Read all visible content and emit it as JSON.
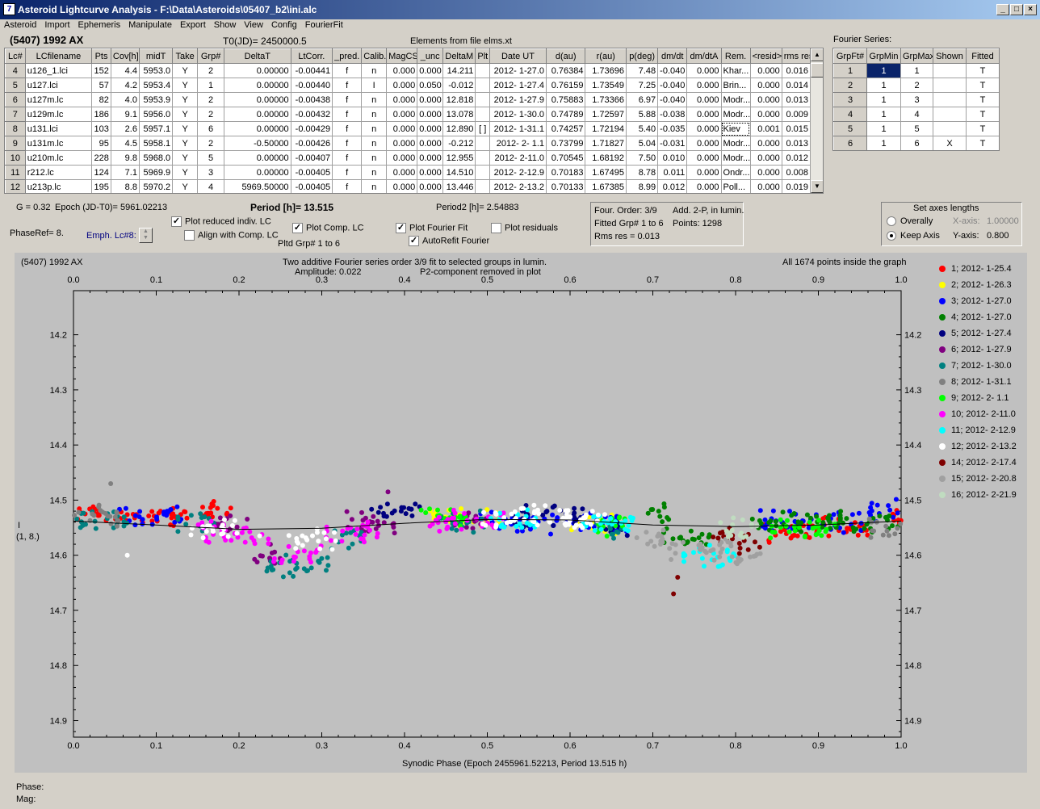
{
  "window": {
    "title": "Asteroid Lightcurve Analysis - F:\\Data\\Asteroids\\05407_b2\\ini.alc",
    "app_icon": "app-logo-icon"
  },
  "menu": [
    "Asteroid",
    "Import",
    "Ephemeris",
    "Manipulate",
    "Export",
    "Show",
    "View",
    "Config",
    "FourierFit"
  ],
  "header": {
    "asteroid": "(5407) 1992 AX",
    "t0": "T0(JD)= 2450000.5",
    "elements": "Elements from file elms.xt"
  },
  "lc_table": {
    "columns": [
      "Lc#",
      "LCfilename",
      "Pts",
      "Cov[h]",
      "midT",
      "Take",
      "Grp#",
      "DeltaT",
      "LtCorr.",
      "_pred.",
      "Calib.",
      "MagCS",
      "_unc",
      "DeltaM",
      "Plt",
      "Date UT",
      "d(au)",
      "r(au)",
      "p(deg)",
      "dm/dt",
      "dm/dtA",
      "Rem.",
      "<resid>",
      "rms res"
    ],
    "rows": [
      [
        "4",
        "u126_1.lci",
        "152",
        "4.4",
        "5953.0",
        "Y",
        "2",
        "0.00000",
        "-0.00441",
        "f",
        "n",
        "0.000",
        "0.000",
        "14.211",
        "",
        "2012- 1-27.0",
        "0.76384",
        "1.73696",
        "7.48",
        "-0.040",
        "0.000",
        "Khar...",
        "0.000",
        "0.016"
      ],
      [
        "5",
        "u127.lci",
        "57",
        "4.2",
        "5953.4",
        "Y",
        "1",
        "0.00000",
        "-0.00440",
        "f",
        "I",
        "0.000",
        "0.050",
        "-0.012",
        "",
        "2012- 1-27.4",
        "0.76159",
        "1.73549",
        "7.25",
        "-0.040",
        "0.000",
        "Brin...",
        "0.000",
        "0.014"
      ],
      [
        "6",
        "u127m.lc",
        "82",
        "4.0",
        "5953.9",
        "Y",
        "2",
        "0.00000",
        "-0.00438",
        "f",
        "n",
        "0.000",
        "0.000",
        "12.818",
        "",
        "2012- 1-27.9",
        "0.75883",
        "1.73366",
        "6.97",
        "-0.040",
        "0.000",
        "Modr...",
        "0.000",
        "0.013"
      ],
      [
        "7",
        "u129m.lc",
        "186",
        "9.1",
        "5956.0",
        "Y",
        "2",
        "0.00000",
        "-0.00432",
        "f",
        "n",
        "0.000",
        "0.000",
        "13.078",
        "",
        "2012- 1-30.0",
        "0.74789",
        "1.72597",
        "5.88",
        "-0.038",
        "0.000",
        "Modr...",
        "0.000",
        "0.009"
      ],
      [
        "8",
        "u131.lci",
        "103",
        "2.6",
        "5957.1",
        "Y",
        "6",
        "0.00000",
        "-0.00429",
        "f",
        "n",
        "0.000",
        "0.000",
        "12.890",
        "[ ]",
        "2012- 1-31.1",
        "0.74257",
        "1.72194",
        "5.40",
        "-0.035",
        "0.000",
        "Kiev",
        "0.001",
        "0.015"
      ],
      [
        "9",
        "u131m.lc",
        "95",
        "4.5",
        "5958.1",
        "Y",
        "2",
        "-0.50000",
        "-0.00426",
        "f",
        "n",
        "0.000",
        "0.000",
        "-0.212",
        "",
        "2012- 2- 1.1",
        "0.73799",
        "1.71827",
        "5.04",
        "-0.031",
        "0.000",
        "Modr...",
        "0.000",
        "0.013"
      ],
      [
        "10",
        "u210m.lc",
        "228",
        "9.8",
        "5968.0",
        "Y",
        "5",
        "0.00000",
        "-0.00407",
        "f",
        "n",
        "0.000",
        "0.000",
        "12.955",
        "",
        "2012- 2-11.0",
        "0.70545",
        "1.68192",
        "7.50",
        "0.010",
        "0.000",
        "Modr...",
        "0.000",
        "0.012"
      ],
      [
        "11",
        "r212.lc",
        "124",
        "7.1",
        "5969.9",
        "Y",
        "3",
        "0.00000",
        "-0.00405",
        "f",
        "n",
        "0.000",
        "0.000",
        "14.510",
        "",
        "2012- 2-12.9",
        "0.70183",
        "1.67495",
        "8.78",
        "0.011",
        "0.000",
        "Ondr...",
        "0.000",
        "0.008"
      ],
      [
        "12",
        "u213p.lc",
        "195",
        "8.8",
        "5970.2",
        "Y",
        "4",
        "5969.50000",
        "-0.00405",
        "f",
        "n",
        "0.000",
        "0.000",
        "13.446",
        "",
        "2012- 2-13.2",
        "0.70133",
        "1.67385",
        "8.99",
        "0.012",
        "0.000",
        "Poll...",
        "0.000",
        "0.019"
      ]
    ]
  },
  "fourier": {
    "title": "Fourier Series:",
    "columns": [
      "GrpFt#",
      "GrpMin",
      "GrpMax",
      "Shown",
      "Fitted"
    ],
    "rows": [
      [
        "1",
        "1",
        "1",
        "",
        "T"
      ],
      [
        "2",
        "1",
        "2",
        "",
        "T"
      ],
      [
        "3",
        "1",
        "3",
        "",
        "T"
      ],
      [
        "4",
        "1",
        "4",
        "",
        "T"
      ],
      [
        "5",
        "1",
        "5",
        "",
        "T"
      ],
      [
        "6",
        "1",
        "6",
        "X",
        "T"
      ]
    ]
  },
  "params": {
    "g": "G = 0.32",
    "epoch": "Epoch (JD-T0)= 5961.02213",
    "period": "Period [h]= 13.515",
    "period2": "Period2 [h]= 2.54883",
    "phaseref": "PhaseRef= 8.",
    "emph": "Emph. Lc#8:",
    "plot_reduced": "Plot reduced indiv. LC",
    "align": "Align with Comp. LC",
    "plot_comp": "Plot Comp. LC",
    "pltd_grp": "Pltd Grp#  1   to    6",
    "plot_fourier": "Plot Fourier Fit",
    "autorefit": "AutoRefit Fourier",
    "plot_resid": "Plot residuals",
    "four_order": "Four. Order:  3/9",
    "add": "Add. 2-P, in lumin.",
    "fitted": "Fitted Grp# 1 to 6",
    "points": "Points: 1298",
    "rms": "Rms res      = 0.013",
    "axes_title": "Set axes lengths",
    "overally": "Overally",
    "keep": "Keep Axis",
    "xaxis_lbl": "X-axis:",
    "xaxis_val": "1.00000",
    "yaxis_lbl": "Y-axis:",
    "yaxis_val": "0.800"
  },
  "plot": {
    "topleft": "(5407) 1992 AX",
    "line1": "Two additive Fourier series order 3/9 fit to selected groups in lumin.",
    "line2": "Amplitude: 0.022",
    "line3": "P2-component removed in plot",
    "topright": "All 1674 points inside the graph",
    "ylabel1": "I",
    "ylabel2": "(1, 8.)",
    "xlabel": "Synodic Phase (Epoch 2455961.52213, Period 13.515 h)"
  },
  "chart_data": {
    "type": "scatter",
    "title": "Two additive Fourier series order 3/9 fit to selected groups in lumin.",
    "xlabel": "Synodic Phase (Epoch 2455961.52213, Period 13.515 h)",
    "ylabel": "I",
    "xlim": [
      0,
      1
    ],
    "ylim": [
      14.93,
      14.12
    ],
    "xticks": [
      "0.0",
      "0.1",
      "0.2",
      "0.3",
      "0.4",
      "0.5",
      "0.6",
      "0.7",
      "0.8",
      "0.9",
      "1.0"
    ],
    "yticks": [
      "14.2",
      "14.3",
      "14.4",
      "14.5",
      "14.6",
      "14.7",
      "14.8",
      "14.9"
    ],
    "legend_position": "right",
    "fourier_fit": [
      [
        0,
        14.538
      ],
      [
        0.1,
        14.545
      ],
      [
        0.2,
        14.553
      ],
      [
        0.3,
        14.551
      ],
      [
        0.4,
        14.542
      ],
      [
        0.5,
        14.535
      ],
      [
        0.6,
        14.536
      ],
      [
        0.7,
        14.545
      ],
      [
        0.8,
        14.548
      ],
      [
        0.9,
        14.545
      ],
      [
        1.0,
        14.538
      ]
    ],
    "series": [
      {
        "name": "1; 2012- 1-25.4",
        "color": "#ff0000",
        "segments": [
          [
            0.0,
            0.03,
            14.52
          ],
          [
            0.03,
            0.14,
            14.53
          ],
          [
            0.15,
            0.2,
            14.52
          ],
          [
            0.82,
            0.89,
            14.56
          ],
          [
            0.89,
            0.96,
            14.55
          ],
          [
            0.99,
            1.0,
            14.53
          ]
        ]
      },
      {
        "name": "2; 2012- 1-26.3",
        "color": "#ffff00",
        "segments": [
          [
            0.43,
            0.52,
            14.535
          ],
          [
            0.6,
            0.66,
            14.54
          ]
        ]
      },
      {
        "name": "3; 2012- 1-27.0",
        "color": "#0000ff",
        "segments": [
          [
            0.05,
            0.13,
            14.53
          ],
          [
            0.49,
            0.67,
            14.54
          ],
          [
            0.83,
            0.96,
            14.54
          ],
          [
            0.96,
            1.0,
            14.52
          ]
        ]
      },
      {
        "name": "4; 2012- 1-27.0",
        "color": "#008000",
        "segments": [
          [
            0.69,
            0.72,
            14.52
          ],
          [
            0.71,
            0.77,
            14.57
          ],
          [
            0.82,
            0.92,
            14.54
          ],
          [
            0.92,
            1.0,
            14.54
          ]
        ]
      },
      {
        "name": "5; 2012- 1-27.4",
        "color": "#00007f",
        "segments": [
          [
            0.36,
            0.42,
            14.52
          ],
          [
            0.53,
            0.62,
            14.53
          ],
          [
            0.64,
            0.67,
            14.55
          ]
        ]
      },
      {
        "name": "6; 2012- 1-27.9",
        "color": "#800080",
        "segments": [
          [
            0.17,
            0.21,
            14.54
          ],
          [
            0.21,
            0.25,
            14.6
          ],
          [
            0.33,
            0.4,
            14.54
          ],
          [
            0.46,
            0.5,
            14.54
          ]
        ]
      },
      {
        "name": "7; 2012- 1-30.0",
        "color": "#008080",
        "segments": [
          [
            0.0,
            0.07,
            14.54
          ],
          [
            0.12,
            0.17,
            14.54
          ],
          [
            0.23,
            0.31,
            14.62
          ],
          [
            0.31,
            0.35,
            14.57
          ],
          [
            0.44,
            0.5,
            14.54
          ],
          [
            0.63,
            0.67,
            14.55
          ]
        ]
      },
      {
        "name": "8; 2012- 1-31.1",
        "color": "#808080",
        "segments": [
          [
            0.0,
            0.06,
            14.53
          ],
          [
            0.96,
            1.0,
            14.55
          ]
        ]
      },
      {
        "name": "9; 2012- 2- 1.1",
        "color": "#00ff00",
        "segments": [
          [
            0.42,
            0.48,
            14.53
          ],
          [
            0.63,
            0.67,
            14.55
          ],
          [
            0.84,
            0.92,
            14.55
          ]
        ]
      },
      {
        "name": "10; 2012- 2-11.0",
        "color": "#ff00ff",
        "segments": [
          [
            0.15,
            0.24,
            14.56
          ],
          [
            0.24,
            0.3,
            14.6
          ],
          [
            0.3,
            0.37,
            14.56
          ],
          [
            0.43,
            0.52,
            14.535
          ]
        ]
      },
      {
        "name": "11; 2012- 2-12.9",
        "color": "#00ffff",
        "segments": [
          [
            0.5,
            0.56,
            14.535
          ],
          [
            0.61,
            0.68,
            14.54
          ],
          [
            0.73,
            0.8,
            14.6
          ]
        ]
      },
      {
        "name": "12; 2012- 2-13.2",
        "color": "#ffffff",
        "segments": [
          [
            0.14,
            0.2,
            14.55
          ],
          [
            0.26,
            0.32,
            14.57
          ],
          [
            0.48,
            0.6,
            14.53
          ],
          [
            0.59,
            0.65,
            14.54
          ]
        ]
      },
      {
        "name": "14; 2012- 2-17.4",
        "color": "#7f0000",
        "segments": [
          [
            0.77,
            0.8,
            14.56
          ],
          [
            0.8,
            0.83,
            14.58
          ]
        ]
      },
      {
        "name": "15; 2012- 2-20.8",
        "color": "#a0a0a0",
        "segments": [
          [
            0.68,
            0.72,
            14.57
          ],
          [
            0.72,
            0.8,
            14.59
          ],
          [
            0.8,
            0.83,
            14.61
          ]
        ]
      },
      {
        "name": "16; 2012- 2-21.9",
        "color": "#c0dcc0",
        "segments": [
          [
            0.78,
            0.83,
            14.55
          ]
        ]
      }
    ]
  }
}
